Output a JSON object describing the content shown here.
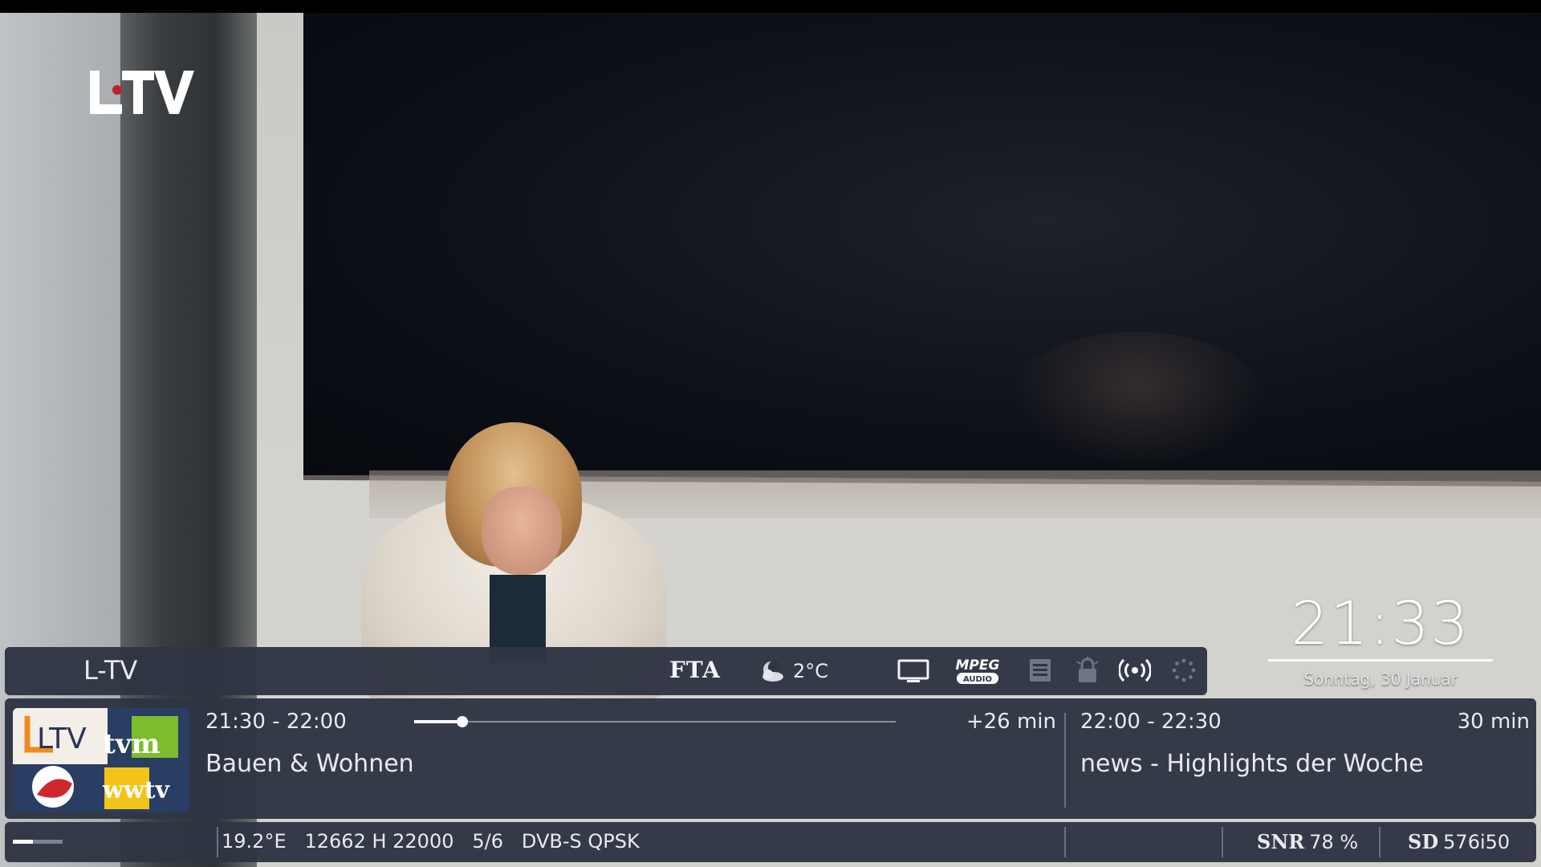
{
  "channel": {
    "name": "L-TV",
    "logo_text": "LTV"
  },
  "clock": {
    "time": "21:33",
    "date": "Sonntag, 30 Januar"
  },
  "status_bar": {
    "encryption": "FTA",
    "weather_icon": "partly-cloudy-night-icon",
    "temperature": "2°C",
    "icons": [
      "tv-screen-icon",
      "mpeg-audio-icon",
      "teletext-icon",
      "lock-icon",
      "signal-broadcast-icon",
      "loading-spinner-icon"
    ],
    "mpeg_label": "MPEG",
    "audio_label": "AUDIO"
  },
  "epg": {
    "now": {
      "time": "21:30 - 22:00",
      "title": "Bauen & Wohnen",
      "remaining": "+26 min",
      "progress": 0.1
    },
    "next": {
      "time": "22:00 - 22:30",
      "title": "news - Highlights der Woche",
      "duration": "30 min"
    },
    "thumbnail_logos": [
      "LTV",
      "tvm",
      "wwtv"
    ]
  },
  "tuner": {
    "signal_level": 0.4,
    "info": "19.2°E   12662 H 22000   5/6   DVB-S QPSK",
    "snr_label": "SNR",
    "snr_value": "78 %",
    "sd_label": "SD",
    "sd_value": "576i50"
  },
  "colors": {
    "panel": "#2f3543",
    "text": "#e8eaee",
    "accent": "#ffffff"
  }
}
